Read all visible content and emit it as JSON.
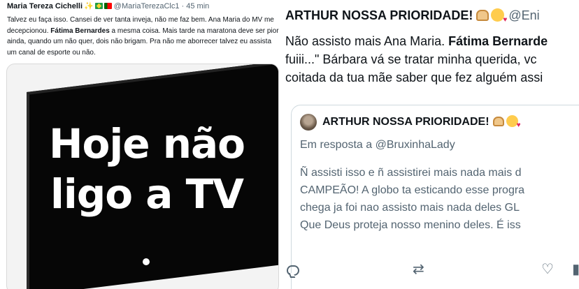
{
  "left_tweet": {
    "author_name": "Maria Tereza Cichelli",
    "handle_time": "@MariaTerezaClc1 · 45 min",
    "body_part1": "Talvez eu faça isso. Cansei de ver tanta inveja, não me faz bem. Ana Maria do MV me decepcionou. ",
    "body_bold": "Fátima Bernardes",
    "body_part2": " a mesma coisa. Mais tarde na maratona deve ser pior ainda, quando um não quer, dois não brigam. Pra não me  aborrecer talvez eu assista um canal de esporte ou não.",
    "image_text_line1": "Hoje não",
    "image_text_line2": "ligo a TV"
  },
  "right_tweet": {
    "author_name": "ARTHUR NOSSA PRIORIDADE!",
    "handle": "@Eni",
    "body_line1_part1": "Não assisto mais Ana Maria. ",
    "body_line1_bold": "Fátima Bernarde",
    "body_line2": "fuiii...\" Bárbara vá se tratar minha querida, vc",
    "body_line3": "coitada da tua mãe saber que fez alguém assi",
    "quoted": {
      "author_name": "ARTHUR NOSSA PRIORIDADE!",
      "reply_to": "Em resposta a @BruxinhaLady",
      "line1": "Ñ assisti isso e ñ assistirei mais nada mais d",
      "line2": "CAMPEÃO! A globo ta esticando esse progra",
      "line3": "chega ja foi nao assisto mais nada deles GL",
      "line4": "Que Deus proteja nosso menino deles. É iss"
    },
    "actions": {
      "reply_icon": "reply-icon",
      "retweet_icon": "retweet-icon",
      "like_icon": "heart-icon",
      "views_icon": "views-icon"
    }
  },
  "colors": {
    "text_primary": "#0f1419",
    "text_secondary": "#536471",
    "border": "#cfd9de",
    "tv_screen": "#060606"
  }
}
